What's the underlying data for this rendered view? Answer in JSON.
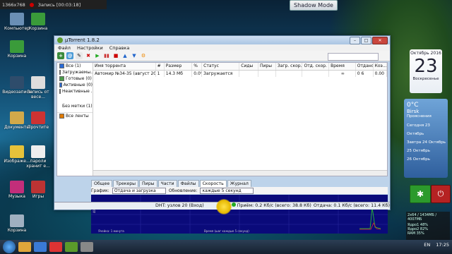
{
  "recorder": {
    "resolution": "1366x768",
    "recording": "Запись [00:03:18]"
  },
  "overlay": {
    "shadow_mode": "Shadow Mode"
  },
  "desktop_icons": [
    "Компьютер",
    "Корзина",
    "Видеозаписи",
    "Документы",
    "Изображе...",
    "Музыка",
    "Игры",
    "Корзина"
  ],
  "desktop_files": {
    "sale": "Запись от весе...",
    "read": "Прочтите",
    "docs": "пароли хранит е..."
  },
  "window": {
    "title": "µTorrent 1.8.2",
    "menu": [
      "Файл",
      "Настройки",
      "Справка"
    ],
    "sidebar": [
      {
        "label": "Все (1)",
        "color": "#2a6bd6"
      },
      {
        "label": "Загружаемы...",
        "color": "#2ca02c"
      },
      {
        "label": "Готовые (0)",
        "color": "#4a9a4a"
      },
      {
        "label": "Активные (0)",
        "color": "#2a6bd6"
      },
      {
        "label": "Неактивные ...",
        "color": "#777777"
      },
      {
        "label": "Без метки (1)",
        "color": ""
      },
      {
        "label": "Все ленты",
        "color": "#e07a00"
      }
    ],
    "columns": [
      "Имя торрента",
      "#",
      "Размер",
      "%",
      "Статус",
      "Сиды",
      "Пиры",
      "Загр. скор.",
      "Отд. скор.",
      "Время",
      "Отдано",
      "Коэ..."
    ],
    "rows": [
      [
        "Автомир №34-35 (август 2016)...",
        "1",
        "14.3 Мб",
        "0.0%",
        "Загружается",
        "",
        "",
        "",
        "",
        "∞",
        "0 6",
        "0.00"
      ]
    ],
    "tabs": [
      "Общее",
      "Трекеры",
      "Пиры",
      "Части",
      "Файлы",
      "Скорость",
      "Журнал"
    ],
    "active_tab": "Скорость",
    "graph_label": "График:",
    "graph_select": "Отдача и загрузка",
    "update_label": "Обновление:",
    "update_select": "каждые 5 секунд",
    "graph_ylabel": "40 Кб/с",
    "graph_note_left": "Ячейка: 1 минута",
    "graph_note_right": "Время (шаг каждые 5 секунд)",
    "status": {
      "dht": "DHT: узлов 20 (Вход)",
      "recv": "Приём: 0.2 Кб/с (всего: 38.8 Кб)",
      "send": "Отдача: 0.1 Кб/с (всего: 11.4 Кб)"
    }
  },
  "calendar": {
    "month": "Октябрь 2016",
    "day": "23",
    "weekday": "Воскресенье"
  },
  "weather": {
    "city": "Birsk",
    "cond": "Прояснения",
    "temp": "0°C",
    "forecast": [
      "Сегодня 23 Октябрь",
      "Завтра 24 Октябрь",
      "25 Октябрь",
      "26 Октябрь"
    ]
  },
  "meter": {
    "title": "2x64 / 1434МБ / 4007МБ",
    "cpu1": "Ядро1 48%",
    "cpu2": "Ядро2 82%",
    "ram": "RAM 35%"
  },
  "tray": {
    "lang": "EN",
    "time": "17:25"
  }
}
